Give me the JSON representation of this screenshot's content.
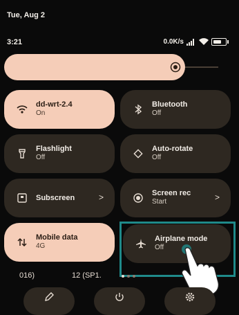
{
  "status": {
    "date": "Tue, Aug 2",
    "time": "3:21",
    "network_speed": "0.0K/s"
  },
  "brightness": {
    "level": 0.85,
    "icon": "brightness-icon"
  },
  "tiles": [
    {
      "title": "dd-wrt-2.4",
      "subtitle": "On",
      "icon": "wifi-icon",
      "active": true
    },
    {
      "title": "Bluetooth",
      "subtitle": "Off",
      "icon": "bluetooth-icon",
      "active": false
    },
    {
      "title": "Flashlight",
      "subtitle": "Off",
      "icon": "flashlight-icon",
      "active": false
    },
    {
      "title": "Auto-rotate",
      "subtitle": "Off",
      "icon": "auto-rotate-icon",
      "active": false
    },
    {
      "title": "Subscreen",
      "subtitle": "",
      "icon": "subscreen-icon",
      "active": false,
      "chevron": ">"
    },
    {
      "title": "Screen rec",
      "subtitle": "Start",
      "icon": "screen-record-icon",
      "active": false,
      "chevron": ">"
    },
    {
      "title": "Mobile data",
      "subtitle": "4G",
      "icon": "mobile-data-icon",
      "active": true
    },
    {
      "title": "Airplane mode",
      "subtitle": "Off",
      "icon": "airplane-icon",
      "active": false
    }
  ],
  "footer": {
    "left_text": "016)",
    "mid_text": "12 (SP1.",
    "page_dots": 3,
    "active_dot": 0
  },
  "bottom_buttons": [
    {
      "icon": "edit-icon"
    },
    {
      "icon": "power-icon"
    },
    {
      "icon": "settings-icon"
    }
  ],
  "colors": {
    "background": "#0a0a0a",
    "tile": "#2e2821",
    "tile_active": "#f5cdb8",
    "highlight": "#1f8a8a"
  }
}
